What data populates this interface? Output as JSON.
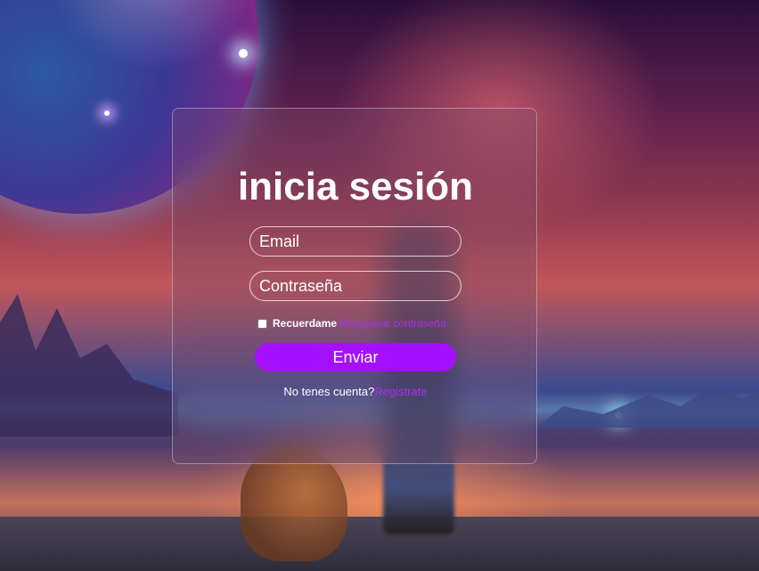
{
  "colors": {
    "accent": "#a50fff",
    "link": "#b02cf0",
    "text": "#ffffff"
  },
  "background": {
    "icon": "space-landscape-illustration"
  },
  "login": {
    "title": "inicia sesión",
    "email": {
      "placeholder": "Email",
      "value": ""
    },
    "password": {
      "placeholder": "Contraseña",
      "value": ""
    },
    "remember": {
      "label": "Recuerdame",
      "checked": false
    },
    "recover_link": "Recuperar contraseña",
    "submit_label": "Enviar",
    "register_prompt": "No tenes cuenta?",
    "register_link": "Registrate"
  }
}
